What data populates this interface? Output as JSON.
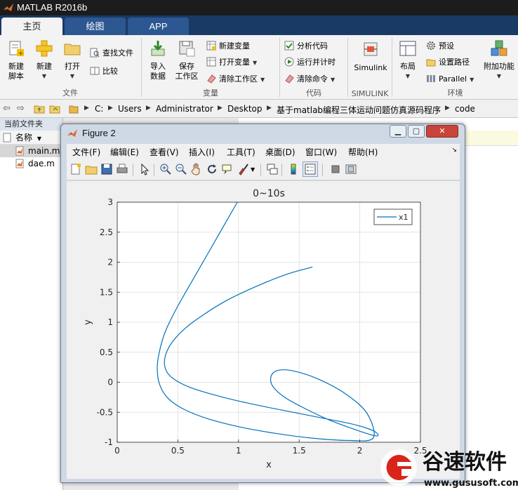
{
  "window": {
    "title": "MATLAB R2016b"
  },
  "tabs": [
    {
      "label": "主页",
      "active": true
    },
    {
      "label": "绘图",
      "active": false
    },
    {
      "label": "APP",
      "active": false
    }
  ],
  "ribbon": {
    "file": {
      "section_label": "文件",
      "new_script": "新建\n脚本",
      "new_script_l1": "新建",
      "new_script_l2": "脚本",
      "new": "新建",
      "open": "打开",
      "find_files": "查找文件",
      "compare": "比较"
    },
    "variable": {
      "section_label": "变量",
      "import_l1": "导入",
      "import_l2": "数据",
      "save_l1": "保存",
      "save_l2": "工作区",
      "new_variable": "新建变量",
      "open_variable": "打开变量",
      "clear_workspace": "清除工作区"
    },
    "code": {
      "section_label": "代码",
      "analyze": "分析代码",
      "run_time": "运行并计时",
      "clear_commands": "清除命令"
    },
    "simulink": {
      "section_label": "SIMULINK",
      "button": "Simulink"
    },
    "environment": {
      "section_label": "环境",
      "layout": "布局",
      "preferences": "预设",
      "set_path": "设置路径",
      "parallel": "Parallel",
      "addons": "附加功能"
    }
  },
  "address": {
    "path": [
      "C:",
      "Users",
      "Administrator",
      "Desktop",
      "基于matlab编程三体运动问题仿真源码程序",
      "code"
    ]
  },
  "file_browser": {
    "title": "当前文件夹",
    "column": "名称",
    "files": [
      {
        "name": "main.m",
        "selected": true
      },
      {
        "name": "dae.m",
        "selected": false
      }
    ]
  },
  "figure": {
    "title": "Figure 2",
    "menu": [
      "文件(F)",
      "编辑(E)",
      "查看(V)",
      "插入(I)",
      "工具(T)",
      "桌面(D)",
      "窗口(W)",
      "帮助(H)"
    ],
    "toolbar_icons": [
      "new-figure-icon",
      "open-icon",
      "save-icon",
      "print-icon",
      "pointer-icon",
      "zoom-in-icon",
      "zoom-out-icon",
      "pan-icon",
      "rotate-icon",
      "data-cursor-icon",
      "brush-icon",
      "link-icon",
      "colorbar-icon",
      "legend-icon",
      "hide-plot-tools-icon",
      "show-plot-tools-icon"
    ]
  },
  "chart_data": {
    "type": "line",
    "title": "0~10s",
    "xlabel": "x",
    "ylabel": "y",
    "xlim": [
      0,
      2.5
    ],
    "ylim": [
      -1,
      3
    ],
    "xticks": [
      "0",
      "0.5",
      "1",
      "1.5",
      "2",
      "2.5"
    ],
    "yticks": [
      "-1",
      "-0.5",
      "0",
      "0.5",
      "1",
      "1.5",
      "2",
      "2.5",
      "3"
    ],
    "grid": true,
    "legend_position": "top-right",
    "series": [
      {
        "name": "x1",
        "color": "#0072BD",
        "x": [
          1.61,
          1.4,
          1.15,
          0.9,
          0.7,
          0.55,
          0.45,
          0.4,
          0.39,
          0.42,
          0.5,
          0.62,
          0.78,
          0.97,
          1.2,
          1.45,
          1.7,
          1.9,
          2.05,
          2.13,
          2.15,
          2.1,
          1.95,
          1.75,
          1.55,
          1.38,
          1.28,
          1.27,
          1.33,
          1.45,
          1.65,
          1.88,
          2.06,
          2.11,
          1.9,
          1.6,
          1.3,
          1.0,
          0.75,
          0.55,
          0.42,
          0.35,
          0.33,
          0.35,
          0.4,
          0.5,
          0.65,
          0.82,
          0.99
        ],
        "y": [
          1.92,
          1.8,
          1.6,
          1.36,
          1.11,
          0.88,
          0.66,
          0.46,
          0.29,
          0.14,
          0.01,
          -0.1,
          -0.2,
          -0.3,
          -0.4,
          -0.5,
          -0.6,
          -0.68,
          -0.76,
          -0.83,
          -0.89,
          -0.88,
          -0.78,
          -0.63,
          -0.44,
          -0.25,
          -0.06,
          0.11,
          0.2,
          0.19,
          0.06,
          -0.19,
          -0.52,
          -0.93,
          -0.97,
          -0.93,
          -0.85,
          -0.74,
          -0.61,
          -0.45,
          -0.27,
          -0.04,
          0.24,
          0.53,
          0.86,
          1.27,
          1.8,
          2.4,
          3.0
        ]
      }
    ]
  },
  "watermark": {
    "brand": "谷速软件",
    "url": "www.gususoft.com"
  }
}
